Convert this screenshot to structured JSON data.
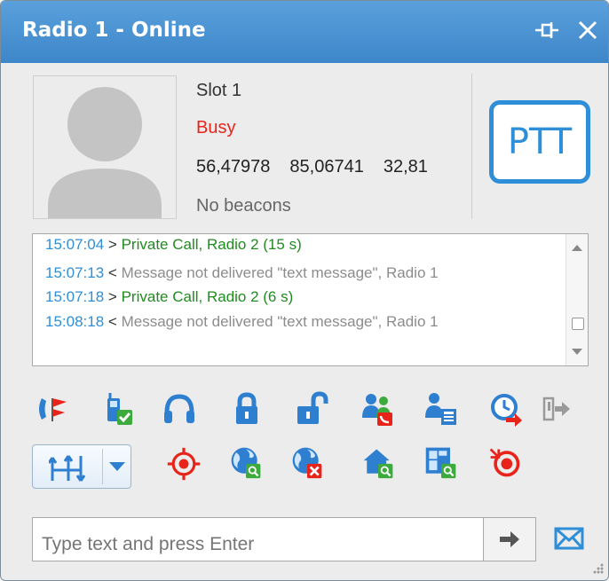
{
  "window": {
    "title": "Radio 1 - Online"
  },
  "radio": {
    "slot": "Slot 1",
    "status": "Busy",
    "coords": [
      "56,47978",
      "85,06741",
      "32,81"
    ],
    "beacons": "No beacons",
    "ptt_label": "PTT"
  },
  "log": [
    {
      "time": "15:07:04",
      "dir": ">",
      "text": "Private Call, Radio 2 (15 s)"
    },
    {
      "time": "15:07:13",
      "dir": "<",
      "text": "Message not delivered \"text message\", Radio 1"
    },
    {
      "time": "15:07:18",
      "dir": ">",
      "text": "Private Call, Radio 2 (6 s)"
    },
    {
      "time": "15:08:18",
      "dir": "<",
      "text": "Message not delivered \"text message\", Radio 1"
    }
  ],
  "message": {
    "placeholder": "Type text and press Enter"
  },
  "colors": {
    "title_bar": "#4a94d4",
    "accent": "#2e8fd8",
    "busy": "#e8241a",
    "call_ok": "#1f8c1f",
    "msg_fail": "#8c8c8c"
  },
  "toolbar_row1": [
    "call-alert-icon",
    "radio-check-icon",
    "headset-icon",
    "lock-icon",
    "unlock-icon",
    "group-call-icon",
    "radio-details-icon",
    "scheduled-task-icon",
    "exit-icon"
  ],
  "toolbar_row2": [
    "channel-split-icon",
    "locate-icon",
    "geofence-search-icon",
    "geofence-remove-icon",
    "home-search-icon",
    "map-search-icon",
    "record-icon"
  ]
}
